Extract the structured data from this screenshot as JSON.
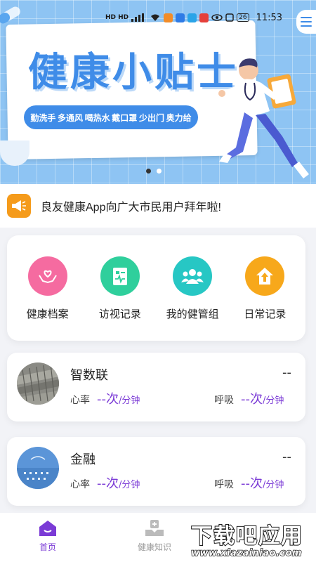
{
  "status_bar": {
    "left": "HD HD",
    "battery": "26",
    "time": "11:53"
  },
  "banner": {
    "title": "健康小贴士",
    "tips": [
      "勤洗手",
      "多通风",
      "喝热水",
      "戴口罩",
      "少出门",
      "奥力给"
    ],
    "active_slide": 1
  },
  "notice": {
    "icon": "megaphone-icon",
    "text": "良友健康App向广大市民用户拜年啦!"
  },
  "quick_actions": [
    {
      "label": "健康档案",
      "icon": "hands-heart-icon",
      "color": "#f56ba0"
    },
    {
      "label": "访视记录",
      "icon": "clipboard-pulse-icon",
      "color": "#2fcf9c"
    },
    {
      "label": "我的健管组",
      "icon": "group-icon",
      "color": "#27c7c4"
    },
    {
      "label": "日常记录",
      "icon": "home-arrow-icon",
      "color": "#f7a81b"
    }
  ],
  "members": [
    {
      "name": "智数联",
      "value": "--",
      "heart_label": "心率",
      "heart_value": "--次",
      "heart_unit": "/分钟",
      "breath_label": "呼吸",
      "breath_value": "--次",
      "breath_unit": "/分钟"
    },
    {
      "name": "金融",
      "value": "--",
      "heart_label": "心率",
      "heart_value": "--次",
      "heart_unit": "/分钟",
      "breath_label": "呼吸",
      "breath_value": "--次",
      "breath_unit": "/分钟"
    }
  ],
  "tabbar": {
    "home_label": "首页",
    "knowledge_label": "健康知识",
    "active_color": "#7b3bd6",
    "inactive_color": "#999999"
  },
  "watermark": {
    "big": "下载吧应用",
    "url": "www.xiazainiao.com"
  }
}
